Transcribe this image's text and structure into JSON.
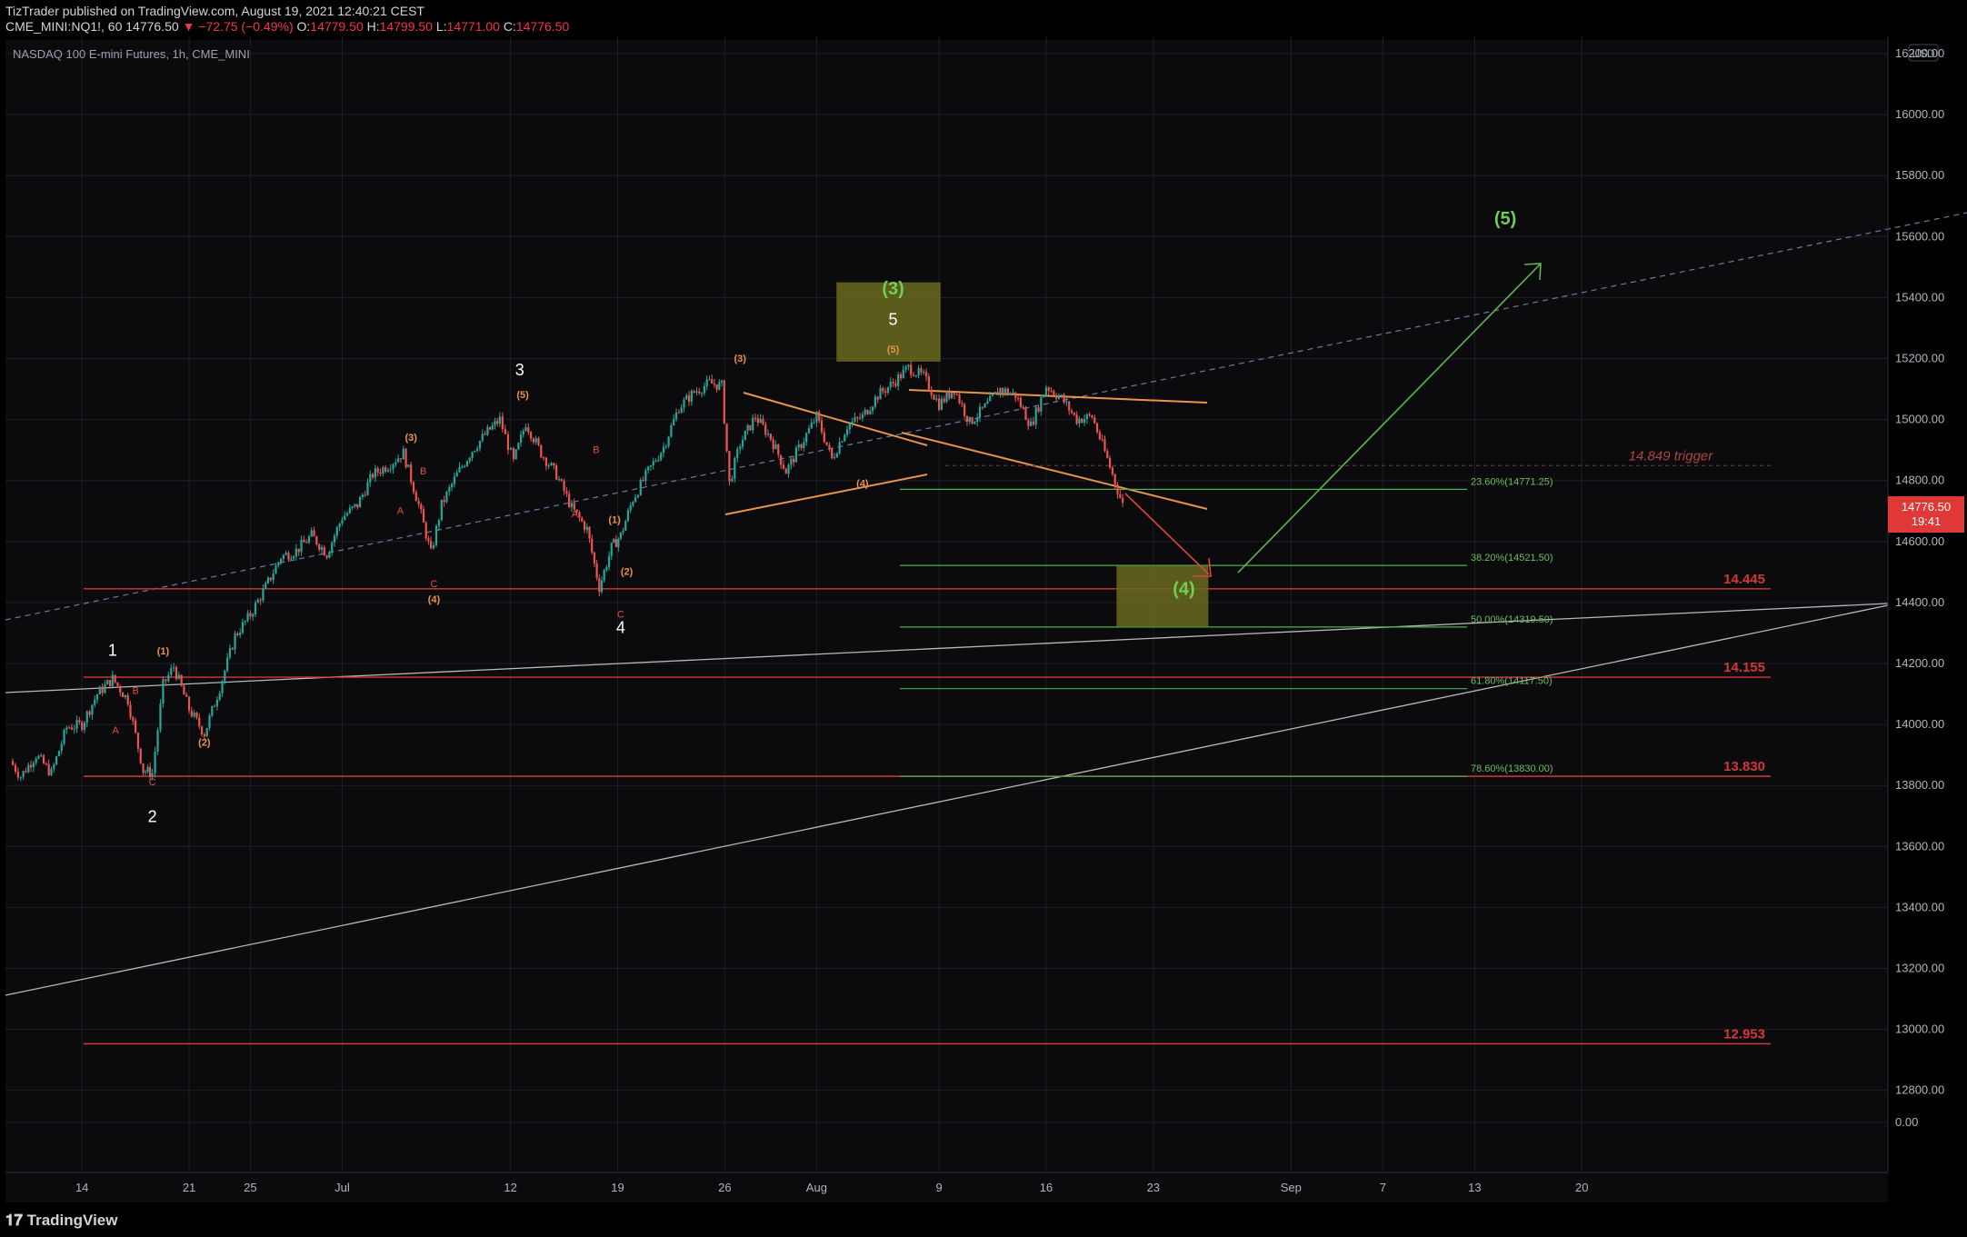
{
  "header": {
    "publisher": "TizTrader published on TradingView.com, August 19, 2021 12:40:21 CEST",
    "symbol": "CME_MINI:NQ1!, 60",
    "last": "14776.50",
    "change": "▼ −72.75 (−0.49%)",
    "open_label": "O:",
    "open": "14779.50",
    "high_label": "H:",
    "high": "14799.50",
    "low_label": "L:",
    "low": "14771.00",
    "close_label": "C:",
    "close": "14776.50"
  },
  "chart_title": "NASDAQ 100 E-mini Futures, 1h, CME_MINI",
  "currency": "USD",
  "price_tag": {
    "value": "14776.50",
    "countdown": "19:41"
  },
  "footer": {
    "brand": "TradingView"
  },
  "colors": {
    "background": "#000000",
    "grid": "#1c1f26",
    "up": "#26a69a",
    "down": "#ef5350",
    "orange": "#e8954a",
    "green": "#5fb64f",
    "red": "#d23838",
    "fib_green": "#4caf50",
    "box_fill": "#6a6a1e"
  },
  "chart_data": {
    "type": "candlestick",
    "title": "NASDAQ 100 E-mini Futures, 1h, CME_MINI",
    "y_ticks": [
      "16200.00",
      "16000.00",
      "15800.00",
      "15600.00",
      "15400.00",
      "15200.00",
      "15000.00",
      "14800.00",
      "14600.00",
      "14400.00",
      "14200.00",
      "14000.00",
      "13800.00",
      "13600.00",
      "13400.00",
      "13200.00",
      "13000.00",
      "12800.00",
      "0.00"
    ],
    "x_ticks": [
      {
        "label": "14",
        "day": 14
      },
      {
        "label": "21",
        "day": 21
      },
      {
        "label": "25",
        "day": 25
      },
      {
        "label": "Jul",
        "day": 31
      },
      {
        "label": "12",
        "day": 42
      },
      {
        "label": "19",
        "day": 49
      },
      {
        "label": "26",
        "day": 56
      },
      {
        "label": "Aug",
        "day": 62
      },
      {
        "label": "9",
        "day": 70
      },
      {
        "label": "16",
        "day": 77
      },
      {
        "label": "23",
        "day": 84
      },
      {
        "label": "Sep",
        "day": 93
      },
      {
        "label": "7",
        "day": 99
      },
      {
        "label": "13",
        "day": 105
      },
      {
        "label": "20",
        "day": 112
      }
    ],
    "x_range_days": [
      9,
      132
    ],
    "y_range": [
      12700,
      16300
    ],
    "zero_tick_price": 12695,
    "price_path": [
      [
        9.3,
        13880
      ],
      [
        10,
        13830
      ],
      [
        11,
        13900
      ],
      [
        12,
        13840
      ],
      [
        13,
        13990
      ],
      [
        14,
        14000
      ],
      [
        15,
        14100
      ],
      [
        16,
        14150
      ],
      [
        17,
        14080
      ],
      [
        18,
        13850
      ],
      [
        18.6,
        13840
      ],
      [
        19.3,
        14130
      ],
      [
        20,
        14190
      ],
      [
        21,
        14050
      ],
      [
        22,
        13970
      ],
      [
        23,
        14120
      ],
      [
        24,
        14290
      ],
      [
        25,
        14360
      ],
      [
        26,
        14450
      ],
      [
        27,
        14550
      ],
      [
        28,
        14570
      ],
      [
        29,
        14620
      ],
      [
        30,
        14560
      ],
      [
        31,
        14680
      ],
      [
        32,
        14720
      ],
      [
        33,
        14820
      ],
      [
        34,
        14850
      ],
      [
        35,
        14890
      ],
      [
        36,
        14720
      ],
      [
        36.8,
        14560
      ],
      [
        37.5,
        14720
      ],
      [
        38.5,
        14820
      ],
      [
        39.5,
        14900
      ],
      [
        40.5,
        14960
      ],
      [
        41.3,
        15000
      ],
      [
        42.2,
        14860
      ],
      [
        43,
        14990
      ],
      [
        44,
        14890
      ],
      [
        45,
        14820
      ],
      [
        46,
        14710
      ],
      [
        47,
        14640
      ],
      [
        47.8,
        14450
      ],
      [
        48.6,
        14580
      ],
      [
        49.2,
        14620
      ],
      [
        50,
        14740
      ],
      [
        51,
        14830
      ],
      [
        52,
        14910
      ],
      [
        53,
        15040
      ],
      [
        54,
        15090
      ],
      [
        55,
        15120
      ],
      [
        55.8,
        15110
      ],
      [
        56.3,
        14790
      ],
      [
        57,
        14920
      ],
      [
        58,
        15010
      ],
      [
        59,
        14940
      ],
      [
        60,
        14830
      ],
      [
        61,
        14920
      ],
      [
        62,
        15010
      ],
      [
        63,
        14870
      ],
      [
        64,
        14980
      ],
      [
        65,
        15010
      ],
      [
        66,
        15080
      ],
      [
        67,
        15120
      ],
      [
        68,
        15170
      ],
      [
        69,
        15140
      ],
      [
        70,
        15050
      ],
      [
        71,
        15100
      ],
      [
        72,
        14990
      ],
      [
        73,
        15040
      ],
      [
        74,
        15100
      ],
      [
        75,
        15080
      ],
      [
        76,
        14980
      ],
      [
        77,
        15110
      ],
      [
        78,
        15070
      ],
      [
        79,
        15000
      ],
      [
        80,
        15010
      ],
      [
        81,
        14870
      ],
      [
        82,
        14720
      ]
    ],
    "horizontal_levels": [
      {
        "label": "14.445",
        "price": 14445
      },
      {
        "label": "14.155",
        "price": 14155
      },
      {
        "label": "13.830",
        "price": 13830
      },
      {
        "label": "12.953",
        "price": 12953
      }
    ],
    "trigger_level": {
      "label": "14.849 trigger",
      "price": 14849
    },
    "fibonacci": [
      {
        "label": "23.60%(14771.25)",
        "price": 14771.25
      },
      {
        "label": "38.20%(14521.50)",
        "price": 14521.5
      },
      {
        "label": "50.00%(14319.50)",
        "price": 14319.5
      },
      {
        "label": "61.80%(14117.50)",
        "price": 14117.5
      },
      {
        "label": "78.60%(13830.00)",
        "price": 13830
      }
    ],
    "wave_labels": {
      "major": [
        {
          "text": "1",
          "day": 16,
          "price": 14225
        },
        {
          "text": "2",
          "day": 18.6,
          "price": 13680
        },
        {
          "text": "3",
          "day": 42.6,
          "price": 15145
        },
        {
          "text": "4",
          "day": 49.2,
          "price": 14300
        },
        {
          "text": "5",
          "day": 67,
          "price": 15310
        }
      ],
      "orange": [
        {
          "text": "(1)",
          "day": 19.3,
          "price": 14230
        },
        {
          "text": "(2)",
          "day": 22,
          "price": 13930
        },
        {
          "text": "(3)",
          "day": 35.5,
          "price": 14930
        },
        {
          "text": "(4)",
          "day": 37,
          "price": 14400
        },
        {
          "text": "(5)",
          "day": 42.8,
          "price": 15070
        },
        {
          "text": "(1)",
          "day": 48.8,
          "price": 14660
        },
        {
          "text": "(2)",
          "day": 49.6,
          "price": 14490
        },
        {
          "text": "(3)",
          "day": 57,
          "price": 15190
        },
        {
          "text": "(4)",
          "day": 65,
          "price": 14780
        },
        {
          "text": "(5)",
          "day": 67,
          "price": 15220
        }
      ],
      "red": [
        {
          "text": "B",
          "day": 17.5,
          "price": 14100
        },
        {
          "text": "A",
          "day": 16.2,
          "price": 13970
        },
        {
          "text": "C",
          "day": 18.6,
          "price": 13800
        },
        {
          "text": "B",
          "day": 36.3,
          "price": 14820
        },
        {
          "text": "A",
          "day": 34.8,
          "price": 14690
        },
        {
          "text": "C",
          "day": 37,
          "price": 14450
        },
        {
          "text": "B",
          "day": 47.6,
          "price": 14890
        },
        {
          "text": "A",
          "day": 46.2,
          "price": 14680
        },
        {
          "text": "C",
          "day": 49.2,
          "price": 14350
        }
      ],
      "green": [
        {
          "text": "(3)",
          "day": 67,
          "price": 15410
        },
        {
          "text": "(4)",
          "day": 86,
          "price": 14425
        },
        {
          "text": "(5)",
          "day": 107,
          "price": 15640
        }
      ]
    },
    "target_boxes": [
      {
        "day_from": 63.3,
        "day_to": 70.1,
        "price_from": 15190,
        "price_to": 15450
      },
      {
        "day_from": 81.6,
        "day_to": 87.6,
        "price_from": 14320,
        "price_to": 14520
      }
    ],
    "grid": true
  }
}
